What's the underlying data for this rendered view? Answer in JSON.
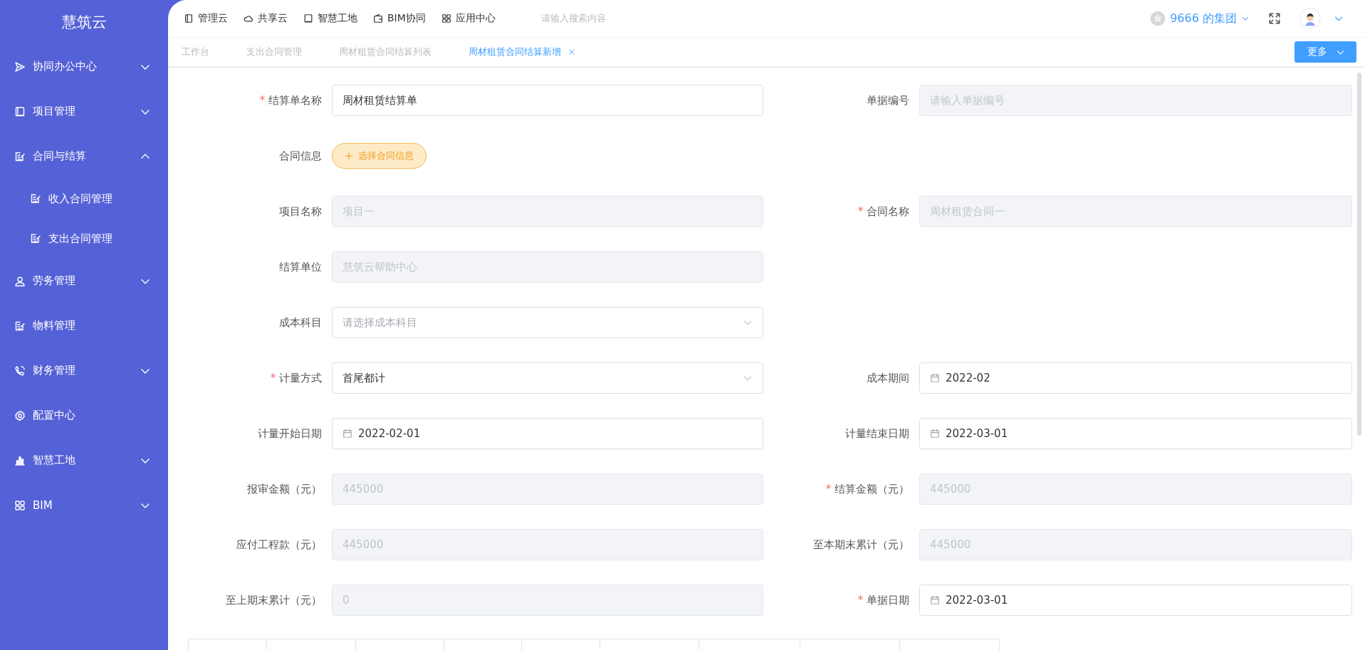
{
  "sidebar": {
    "logo": "慧筑云",
    "items": [
      {
        "label": "协同办公中心",
        "expanded": false
      },
      {
        "label": "项目管理",
        "expanded": false
      },
      {
        "label": "合同与结算",
        "expanded": true,
        "children": [
          {
            "label": "收入合同管理"
          },
          {
            "label": "支出合同管理"
          }
        ]
      },
      {
        "label": "劳务管理",
        "expanded": false
      },
      {
        "label": "物料管理"
      },
      {
        "label": "财务管理",
        "expanded": false
      },
      {
        "label": "配置中心"
      },
      {
        "label": "智慧工地",
        "expanded": false
      },
      {
        "label": "BIM",
        "expanded": false
      }
    ]
  },
  "top_nav": {
    "links": [
      {
        "label": "管理云"
      },
      {
        "label": "共享云"
      },
      {
        "label": "智慧工地"
      },
      {
        "label": "BIM协同"
      },
      {
        "label": "应用中心"
      }
    ],
    "search": {
      "placeholder": "请输入搜索内容"
    },
    "organization": "9666 的集团"
  },
  "tabs": [
    {
      "label": "工作台",
      "selected": false,
      "closable": false
    },
    {
      "label": "支出合同管理",
      "selected": false,
      "closable": false
    },
    {
      "label": "周材租赁合同结算列表",
      "selected": false,
      "closable": false
    },
    {
      "label": "周材租赁合同结算新增",
      "selected": true,
      "closable": true
    }
  ],
  "more_button": "更多",
  "form": {
    "rows": [
      {
        "left": {
          "marker": "*",
          "label": "结算单名称",
          "kind": "input",
          "value": "周材租赁结算单",
          "disabled": false
        },
        "right": {
          "label": "单据编号",
          "kind": "input",
          "placeholder": "请输入单据编号",
          "disabled": true
        }
      },
      {
        "left": {
          "label": "合同信息",
          "kind": "button",
          "value": "选择合同信息"
        }
      },
      {
        "left": {
          "label": "项目名称",
          "kind": "input",
          "value": "项目一",
          "disabled": true
        },
        "right": {
          "marker": "*",
          "label": "合同名称",
          "kind": "input",
          "value": "周材租赁合同一",
          "disabled": true
        }
      },
      {
        "left": {
          "label": "结算单位",
          "kind": "input",
          "value": "慧筑云帮助中心",
          "disabled": true
        }
      },
      {
        "left": {
          "label": "成本科目",
          "kind": "select",
          "placeholder": "请选择成本科目",
          "disabled": false
        }
      },
      {
        "left": {
          "marker": "*",
          "label": "计量方式",
          "kind": "select",
          "value": "首尾都计",
          "disabled": false
        },
        "right": {
          "label": "成本期间",
          "kind": "date",
          "value": "2022-02",
          "disabled": false
        }
      },
      {
        "left": {
          "label": "计量开始日期",
          "kind": "date",
          "value": "2022-02-01",
          "disabled": false
        },
        "right": {
          "label": "计量结束日期",
          "kind": "date",
          "value": "2022-03-01",
          "disabled": false
        }
      },
      {
        "left": {
          "label": "报审金额（元）",
          "kind": "input",
          "value": "445000",
          "disabled": true
        },
        "right": {
          "marker": "*",
          "label": "结算金额（元）",
          "kind": "input",
          "value": "445000",
          "disabled": true
        }
      },
      {
        "left": {
          "label": "应付工程款（元）",
          "kind": "input",
          "value": "445000",
          "disabled": true
        },
        "right": {
          "label": "至本期末累计（元）",
          "kind": "input",
          "value": "445000",
          "disabled": true
        }
      },
      {
        "left": {
          "label": "至上期末累计（元）",
          "kind": "input",
          "value": "0",
          "disabled": true
        },
        "right": {
          "marker": "*",
          "label": "单据日期",
          "kind": "date",
          "value": "2022-03-01",
          "disabled": false
        }
      }
    ]
  }
}
